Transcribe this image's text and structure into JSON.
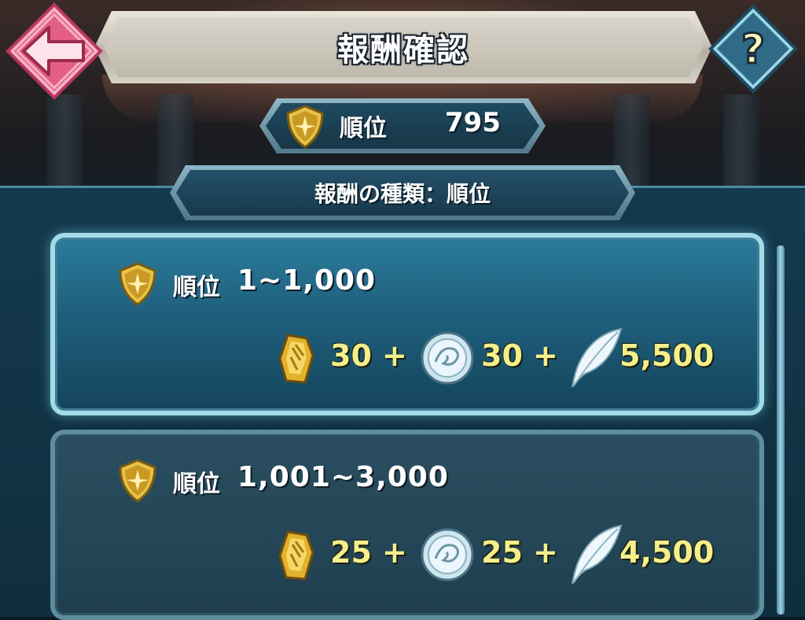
{
  "header": {
    "title": "報酬確認"
  },
  "current_rank": {
    "label": "順位",
    "value": "795"
  },
  "reward_type": {
    "label": "報酬の種類：順位"
  },
  "rewards": [
    {
      "rank_label": "順位",
      "range": "1~1,000",
      "items": [
        {
          "icon": "crest-badge-icon",
          "amount": "30"
        },
        {
          "icon": "divine-coin-icon",
          "amount": "30"
        },
        {
          "icon": "feather-icon",
          "amount": "5,500"
        }
      ]
    },
    {
      "rank_label": "順位",
      "range": "1,001~3,000",
      "items": [
        {
          "icon": "crest-badge-icon",
          "amount": "25"
        },
        {
          "icon": "divine-coin-icon",
          "amount": "25"
        },
        {
          "icon": "feather-icon",
          "amount": "4,500"
        }
      ]
    }
  ],
  "plus_sign": "+",
  "colors": {
    "reward_amount": "#f4ef8a",
    "back_button": "#e35f85",
    "help_button": "#2f6a86"
  }
}
